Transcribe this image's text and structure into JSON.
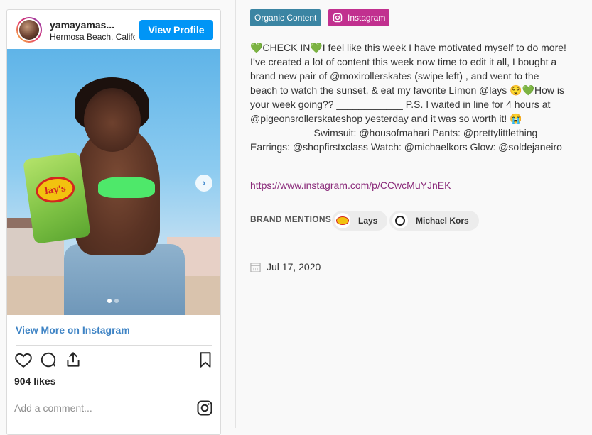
{
  "embed": {
    "username": "yamayamas...",
    "location": "Hermosa Beach, California",
    "view_profile_label": "View Profile",
    "view_more_label": "View More on Instagram",
    "likes_text": "904 likes",
    "comment_placeholder": "Add a comment...",
    "photo_brand_text": "lay's",
    "carousel": {
      "total": 2,
      "current": 1
    }
  },
  "tags": {
    "organic": "Organic Content",
    "platform": "Instagram"
  },
  "caption": "💚CHECK IN💚I feel like this week I have motivated myself to do more! I’ve created a lot of content this week now time to edit it all, I bought a brand new pair of @moxirollerskates (swipe left) , and went to the beach to watch the sunset, & eat my favorite Límon @lays 😌💚How is your week going?? ____________ P.S. I waited in line for 4 hours at @pigeonsrollerskateshop yesterday and it was so worth it! 😭___________ Swimsuit: @housofmahari Pants: @prettylittlething Earrings: @shopfirstxclass Watch: @michaelkors Glow: @soldejaneiro",
  "post_url": "https://www.instagram.com/p/CCwcMuYJnEK",
  "brand_mentions": {
    "label": "BRAND MENTIONS",
    "brands": [
      {
        "name": "Lays"
      },
      {
        "name": "Michael Kors"
      }
    ]
  },
  "date": "Jul 17, 2020",
  "colors": {
    "primary_button": "#0095f6",
    "organic_badge": "#3b85a3",
    "instagram_badge": "#c1308f",
    "link": "#8a2a7a"
  }
}
